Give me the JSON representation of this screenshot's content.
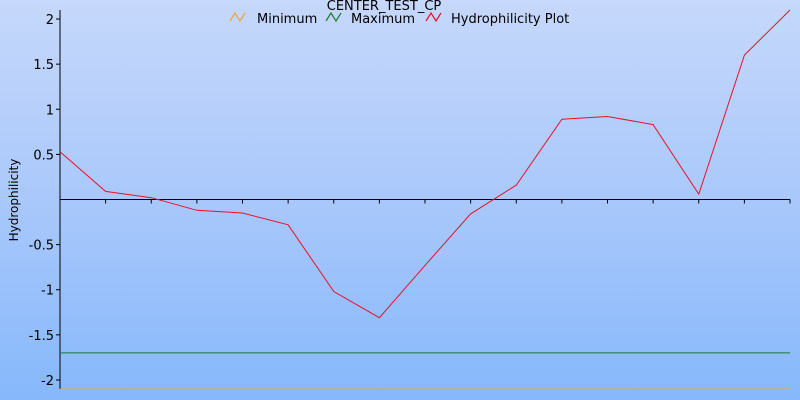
{
  "chart_data": {
    "type": "line",
    "title": "CENTER_TEST_CP",
    "ylabel": "Hydrophilicity",
    "xlabel": "",
    "ylim": [
      -2.1,
      2.1
    ],
    "xlim": [
      1,
      17
    ],
    "yticks": [
      2,
      1.5,
      1,
      0.5,
      -0.5,
      -1,
      -1.5,
      -2
    ],
    "ytick_labels": [
      "2",
      "1.5",
      "1",
      "0.5",
      "-0.5",
      "-1",
      "-1.5",
      "-2"
    ],
    "legend_position": "top",
    "grid": false,
    "series": [
      {
        "name": "Minimum",
        "color": "#e8a640",
        "x": [
          1,
          17
        ],
        "values": [
          -2.1,
          -2.1
        ]
      },
      {
        "name": "Maximum",
        "color": "#1e7a2e",
        "x": [
          1,
          17
        ],
        "values": [
          -1.7,
          -1.7
        ]
      },
      {
        "name": "Hydrophilicity Plot",
        "color": "#e8102a",
        "x": [
          1,
          2,
          3,
          4,
          5,
          6,
          7,
          8,
          9,
          10,
          11,
          12,
          13,
          14,
          15,
          16,
          17
        ],
        "values": [
          0.53,
          0.09,
          0.02,
          -0.12,
          -0.15,
          -0.28,
          -1.02,
          -1.31,
          -0.73,
          -0.16,
          0.16,
          0.89,
          0.92,
          0.83,
          0.06,
          1.6,
          2.1
        ]
      }
    ]
  }
}
